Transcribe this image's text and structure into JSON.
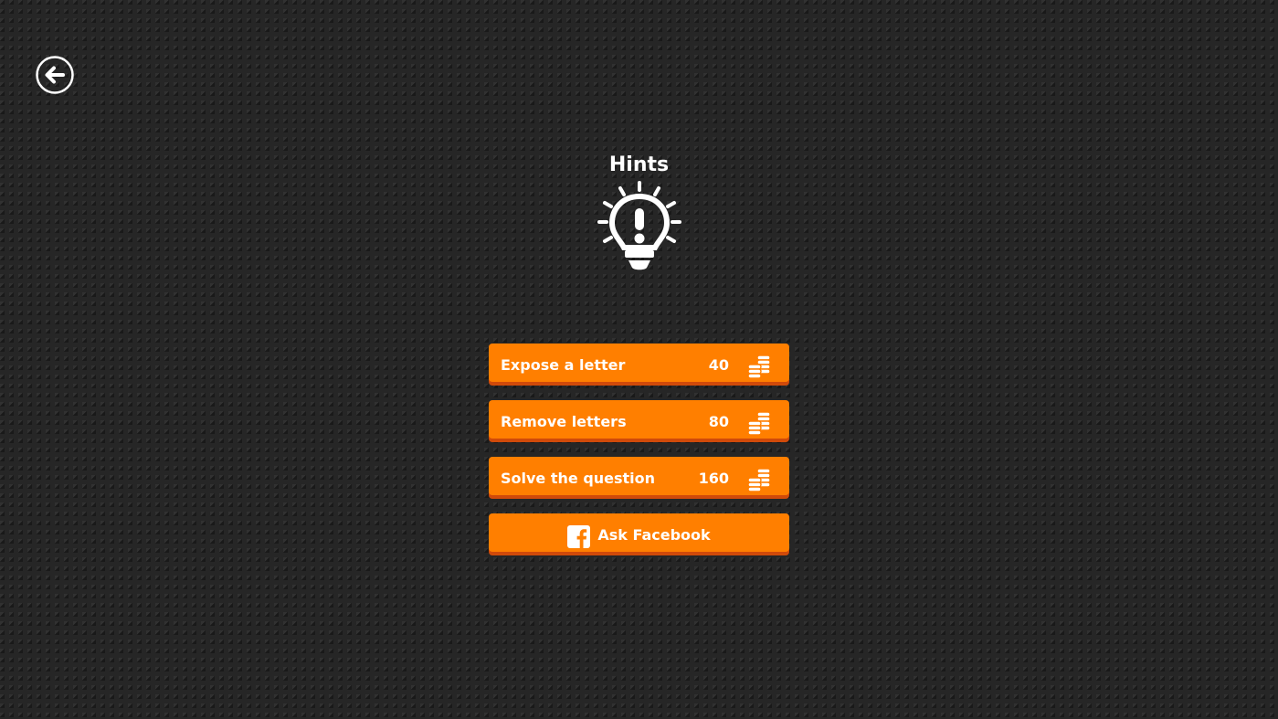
{
  "screen": {
    "title": "Hints",
    "title_icon": "lightbulb-exclamation-icon",
    "back_icon": "arrow-left-circle-icon"
  },
  "hints": [
    {
      "label": "Expose a letter",
      "cost": "40",
      "icon": "coins-icon"
    },
    {
      "label": "Remove letters",
      "cost": "80",
      "icon": "coins-icon"
    },
    {
      "label": "Solve the question",
      "cost": "160",
      "icon": "coins-icon"
    }
  ],
  "facebook": {
    "label": "Ask Facebook",
    "icon": "facebook-icon"
  },
  "colors": {
    "background": "#262626",
    "button": "#ff7f00",
    "button_shadow": "#d04a0a",
    "text": "#ffffff"
  }
}
